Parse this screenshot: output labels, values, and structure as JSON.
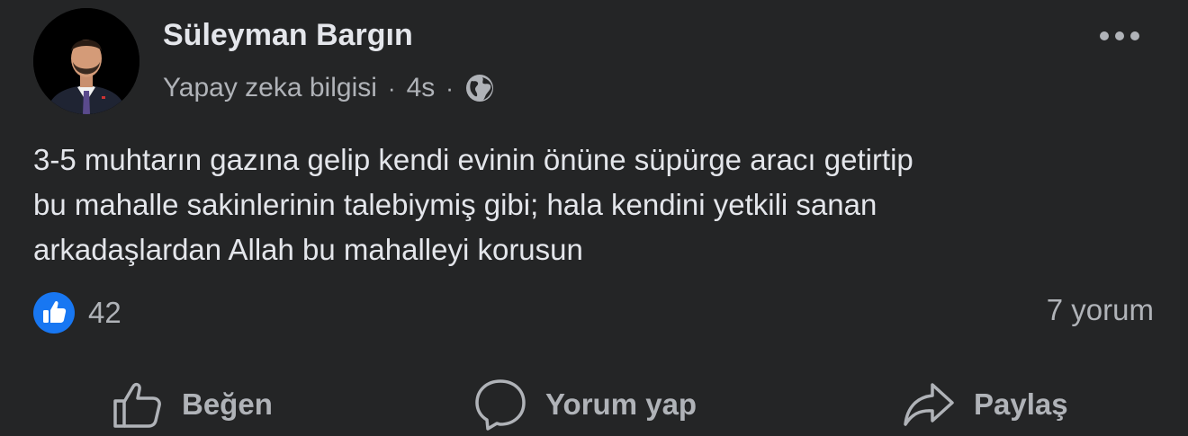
{
  "post": {
    "author": {
      "name": "Süleyman Bargın",
      "subtitle": "Yapay zeka bilgisi",
      "time": "4s",
      "separator": "·"
    },
    "text": "3-5 muhtarın gazına gelip kendi evinin önüne süpürge aracı getirtip\nbu mahalle sakinlerinin talebiymiş gibi; hala kendini yetkili sanan\narkadaşlardan Allah bu mahalleyi korusun",
    "reactions": {
      "count": "42",
      "icon": "like-icon",
      "color": "#1877f2"
    },
    "comments": {
      "label": "7 yorum"
    },
    "actions": {
      "like_label": "Beğen",
      "comment_label": "Yorum yap",
      "share_label": "Paylaş"
    },
    "colors": {
      "background": "#242526",
      "primary_text": "#e4e6eb",
      "secondary_text": "#b0b3b8",
      "accent": "#1877f2"
    }
  }
}
